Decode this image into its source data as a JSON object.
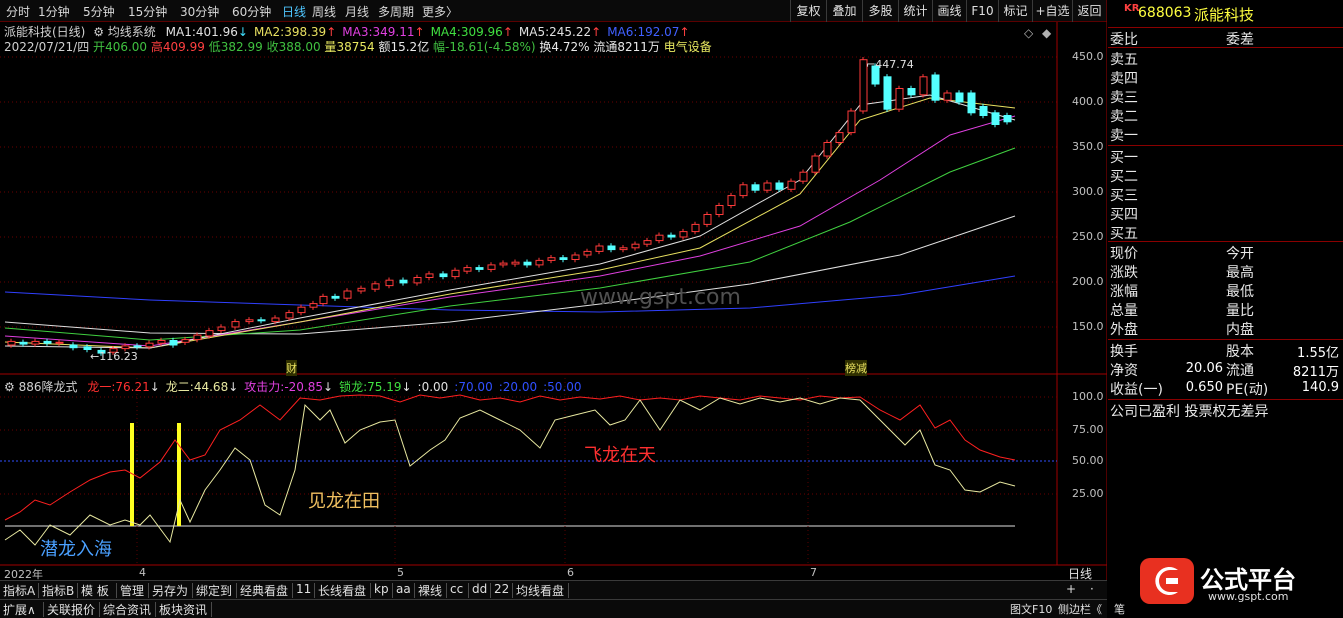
{
  "toolbar": {
    "periods": [
      "分时",
      "1分钟",
      "5分钟",
      "15分钟",
      "30分钟",
      "60分钟",
      "日线",
      "周线",
      "月线",
      "多周期",
      "更多"
    ],
    "selected_period": "日线",
    "more_arrow": "〉",
    "actions": [
      "复权",
      "叠加",
      "多股",
      "统计",
      "画线",
      "F10",
      "标记",
      "+自选",
      "返回"
    ]
  },
  "header": {
    "stock_title": "派能科技(日线)",
    "ma_system": "均线系统",
    "ma": [
      {
        "label": "MA1:",
        "value": "401.96",
        "arrow": "↓",
        "color": "#e0e0e0"
      },
      {
        "label": "MA2:",
        "value": "398.39",
        "arrow": "↑",
        "color": "#e8e060"
      },
      {
        "label": "MA3:",
        "value": "349.11",
        "arrow": "↑",
        "color": "#e040e0"
      },
      {
        "label": "MA4:",
        "value": "309.96",
        "arrow": "↑",
        "color": "#40e040"
      },
      {
        "label": "MA5:",
        "value": "245.22",
        "arrow": "↑",
        "color": "#e0e0e0"
      },
      {
        "label": "MA6:",
        "value": "192.07",
        "arrow": "↑",
        "color": "#4060ff"
      }
    ],
    "quote_date": "2022/07/21/四",
    "open": {
      "label": "开",
      "value": "406.00"
    },
    "high": {
      "label": "高",
      "value": "409.99"
    },
    "low": {
      "label": "低",
      "value": "382.99"
    },
    "close": {
      "label": "收",
      "value": "388.00"
    },
    "volume": {
      "label": "量",
      "value": "38754"
    },
    "amount": {
      "label": "额",
      "value": "15.2亿"
    },
    "change": {
      "label": "幅",
      "value": "-18.61(-4.58%)"
    },
    "turnover": {
      "label": "换",
      "value": "4.72%"
    },
    "float": {
      "label": "流通",
      "value": "8211万"
    },
    "sector": "电气设备"
  },
  "price_axis": [
    "450.0",
    "400.0",
    "350.0",
    "300.0",
    "250.0",
    "200.0",
    "150.0"
  ],
  "price_labels": {
    "high": "447.74",
    "low": "116.23",
    "cai": "财",
    "bangjian": "榜减"
  },
  "watermark": "www.gspt.com",
  "indicator": {
    "name": "886降龙式",
    "items": [
      {
        "label": "龙一:",
        "value": "76.21",
        "arrow": "↓",
        "color": "#ff3030"
      },
      {
        "label": "龙二:",
        "value": "44.68",
        "arrow": "↓",
        "color": "#e8e8a0"
      },
      {
        "label": "攻击力:",
        "value": "-20.85",
        "arrow": "↓",
        "color": "#e040e0"
      },
      {
        "label": "锁龙:",
        "value": "75.19",
        "arrow": "↓",
        "color": "#40e040"
      },
      {
        "label": ":",
        "value": "0.00",
        "arrow": "",
        "color": "#e0e0e0"
      },
      {
        "label": ":",
        "value": "70.00",
        "arrow": "",
        "color": "#3050ff"
      },
      {
        "label": ":",
        "value": "20.00",
        "arrow": "",
        "color": "#3050ff"
      },
      {
        "label": ":",
        "value": "50.00",
        "arrow": "",
        "color": "#3050ff"
      }
    ],
    "axis": [
      "100.0",
      "75.00",
      "50.00",
      "25.00"
    ],
    "phrases": {
      "p1": "潜龙入海",
      "p2": "见龙在田",
      "p3": "飞龙在天"
    }
  },
  "time_axis": {
    "year": "2022年",
    "m4": "4",
    "m5": "5",
    "m6": "6",
    "m7": "7",
    "period": "日线"
  },
  "bottom_tabs": [
    "指标A",
    "指标B",
    "模 板",
    "管理",
    "另存为",
    "绑定到",
    "经典看盘",
    "11",
    "长线看盘",
    "kp",
    "aa",
    "裸线",
    "cc",
    "dd",
    "22",
    "均线看盘"
  ],
  "bottom_tabs2": [
    "扩展∧",
    "关联报价",
    "综合资讯",
    "板块资讯"
  ],
  "bottom_right": {
    "f10": "图文F10",
    "side": "侧边栏《",
    "plus": "+",
    "dot": "·",
    "pen": "笔"
  },
  "panel": {
    "market_tag": "KR",
    "code": "688063",
    "name": "派能科技",
    "weibi": "委比",
    "weicha": "委差",
    "sell": [
      "卖五",
      "卖四",
      "卖三",
      "卖二",
      "卖一"
    ],
    "buy": [
      "买一",
      "买二",
      "买三",
      "买四",
      "买五"
    ],
    "quote_left": [
      "现价",
      "涨跌",
      "涨幅",
      "总量",
      "外盘"
    ],
    "quote_right": [
      "今开",
      "最高",
      "最低",
      "量比",
      "内盘"
    ],
    "stats": [
      {
        "l": "换手",
        "r": "股本",
        "rv": "1.55亿"
      },
      {
        "l": "净资",
        "lv": "20.06",
        "r": "流通",
        "rv": "8211万"
      },
      {
        "l": "收益(一)",
        "lv": "0.650",
        "r": "PE(动)",
        "rv": "140.9"
      }
    ],
    "note": "公司已盈利 投票权无差异"
  },
  "brand": {
    "name": "公式平台",
    "url": "www.gspt.com"
  }
}
